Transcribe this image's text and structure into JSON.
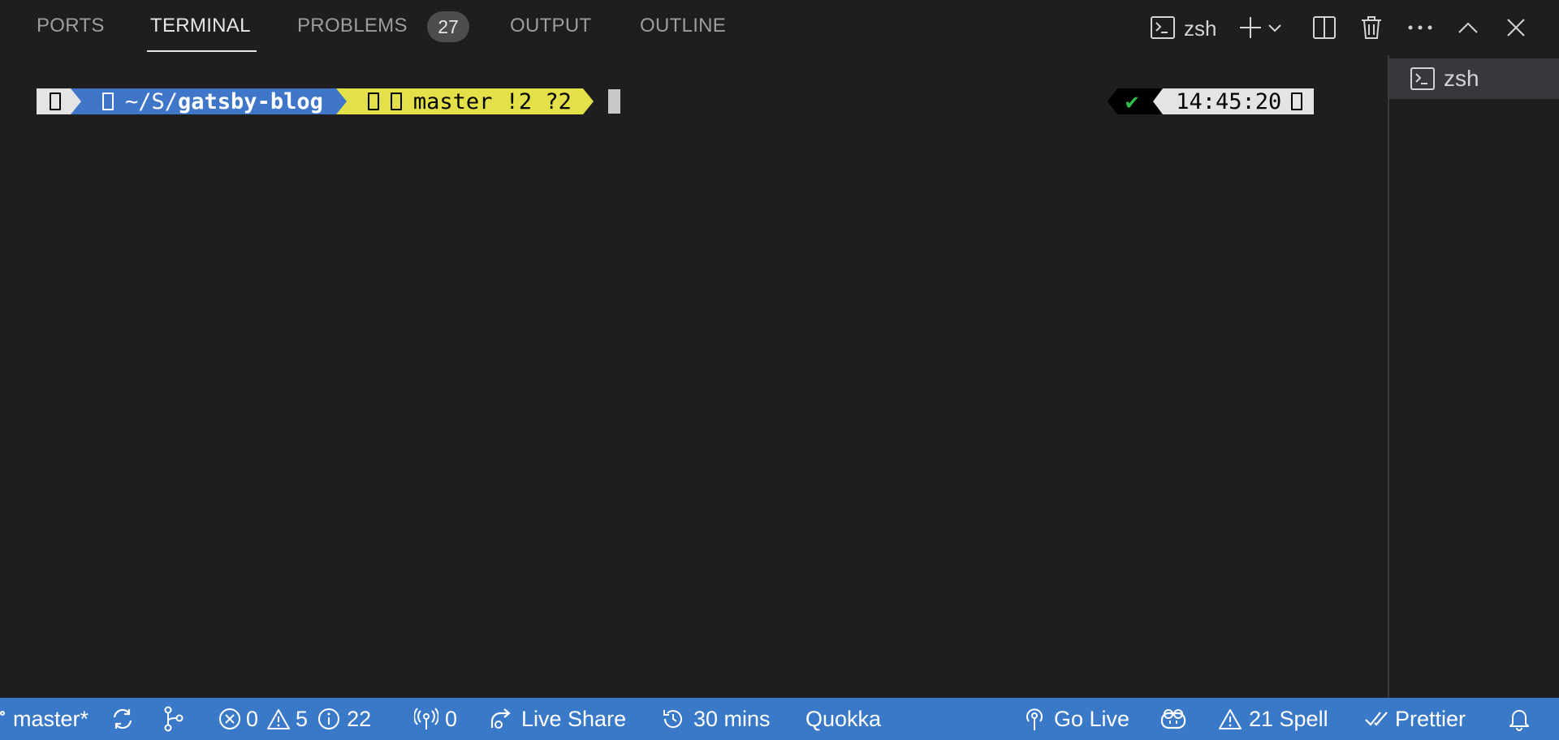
{
  "tabs": [
    {
      "label": "PORTS"
    },
    {
      "label": "TERMINAL"
    },
    {
      "label": "PROBLEMS"
    },
    {
      "label": "OUTPUT"
    },
    {
      "label": "OUTLINE"
    }
  ],
  "problems_count": "27",
  "toolbar": {
    "shell_name": "zsh"
  },
  "terminal": {
    "path_prefix": "~/S/",
    "path_dir": "gatsby-blog",
    "git_branch": "master !2 ?2",
    "status_mark": "✔",
    "time": "14:45:20"
  },
  "terminal_list": {
    "items": [
      {
        "label": "zsh"
      }
    ]
  },
  "statusbar": {
    "branch": "master*",
    "errors": "0",
    "warnings": "5",
    "infos": "22",
    "ports": "0",
    "live_share": "Live Share",
    "time_tracker": "30 mins",
    "quokka": "Quokka",
    "go_live": "Go Live",
    "spell": "21 Spell",
    "prettier": "Prettier"
  },
  "colors": {
    "accent_statusbar": "#3a79c8",
    "prompt_dir": "#3f76c8",
    "prompt_git": "#e3e04a",
    "status_ok": "#2fbf4f"
  }
}
